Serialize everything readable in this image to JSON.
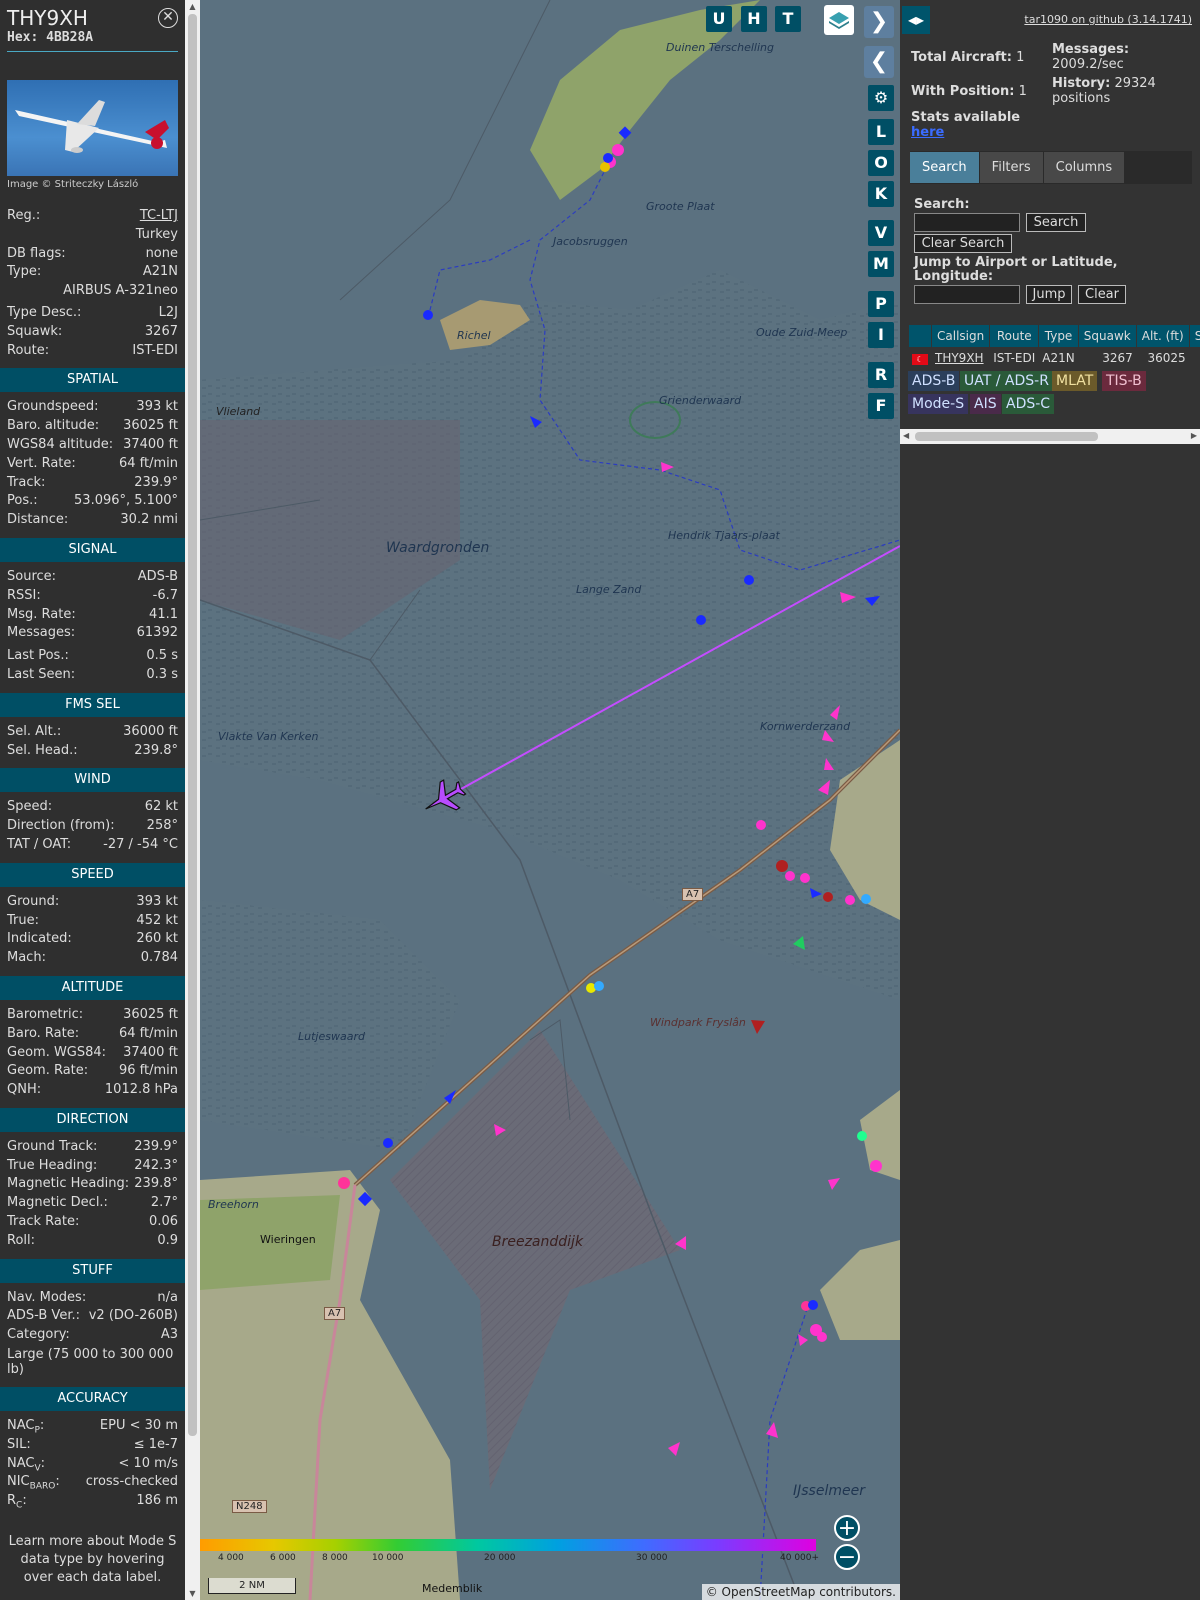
{
  "aircraft": {
    "callsign": "THY9XH",
    "hex": "Hex: 4BB28A",
    "image_credit": "Image © Striteczky László"
  },
  "info": {
    "reg_label": "Reg.:",
    "reg_value": "TC-LTJ",
    "country": "Turkey",
    "dbflags_label": "DB flags:",
    "dbflags_value": "none",
    "type_label": "Type:",
    "type_value": "A21N",
    "type_name": "AIRBUS A-321neo",
    "typedesc_label": "Type Desc.:",
    "typedesc_value": "L2J",
    "squawk_label": "Squawk:",
    "squawk_value": "3267",
    "route_label": "Route:",
    "route_value": "IST-EDI"
  },
  "spatial": {
    "title": "SPATIAL",
    "rows": [
      {
        "k": "Groundspeed:",
        "v": "393 kt"
      },
      {
        "k": "Baro. altitude:",
        "v": "36025 ft"
      },
      {
        "k": "WGS84 altitude:",
        "v": "37400 ft"
      },
      {
        "k": "Vert. Rate:",
        "v": "64 ft/min"
      },
      {
        "k": "Track:",
        "v": "239.9°"
      },
      {
        "k": "Pos.:",
        "v": "53.096°, 5.100°"
      },
      {
        "k": "Distance:",
        "v": "30.2 nmi"
      }
    ]
  },
  "signal": {
    "title": "SIGNAL",
    "rows": [
      {
        "k": "Source:",
        "v": "ADS-B"
      },
      {
        "k": "RSSI:",
        "v": "-6.7"
      },
      {
        "k": "Msg. Rate:",
        "v": "41.1"
      },
      {
        "k": "Messages:",
        "v": "61392"
      },
      {
        "k": "Last Pos.:",
        "v": "0.5 s"
      },
      {
        "k": "Last Seen:",
        "v": "0.3 s"
      }
    ]
  },
  "fms": {
    "title": "FMS SEL",
    "rows": [
      {
        "k": "Sel. Alt.:",
        "v": "36000 ft"
      },
      {
        "k": "Sel. Head.:",
        "v": "239.8°"
      }
    ]
  },
  "wind": {
    "title": "WIND",
    "rows": [
      {
        "k": "Speed:",
        "v": "62 kt"
      },
      {
        "k": "Direction (from):",
        "v": "258°"
      },
      {
        "k": "TAT / OAT:",
        "v": "-27 / -54 °C"
      }
    ]
  },
  "speed": {
    "title": "SPEED",
    "rows": [
      {
        "k": "Ground:",
        "v": "393 kt"
      },
      {
        "k": "True:",
        "v": "452 kt"
      },
      {
        "k": "Indicated:",
        "v": "260 kt"
      },
      {
        "k": "Mach:",
        "v": "0.784"
      }
    ]
  },
  "altitude": {
    "title": "ALTITUDE",
    "rows": [
      {
        "k": "Barometric:",
        "v": "36025 ft"
      },
      {
        "k": "Baro. Rate:",
        "v": "64 ft/min"
      },
      {
        "k": "Geom. WGS84:",
        "v": "37400 ft"
      },
      {
        "k": "Geom. Rate:",
        "v": "96 ft/min"
      },
      {
        "k": "QNH:",
        "v": "1012.8 hPa"
      }
    ]
  },
  "direction": {
    "title": "DIRECTION",
    "rows": [
      {
        "k": "Ground Track:",
        "v": "239.9°"
      },
      {
        "k": "True Heading:",
        "v": "242.3°"
      },
      {
        "k": "Magnetic Heading:",
        "v": "239.8°"
      },
      {
        "k": "Magnetic Decl.:",
        "v": "2.7°"
      },
      {
        "k": "Track Rate:",
        "v": "0.06"
      },
      {
        "k": "Roll:",
        "v": "0.9"
      }
    ]
  },
  "stuff": {
    "title": "STUFF",
    "rows": [
      {
        "k": "Nav. Modes:",
        "v": "n/a"
      },
      {
        "k": "ADS-B Ver.:",
        "v": "v2 (DO-260B)"
      },
      {
        "k": "Category:",
        "v": "A3"
      }
    ],
    "category_desc": "Large (75 000 to 300 000 lb)"
  },
  "accuracy": {
    "title": "ACCURACY",
    "nacp_k": "NAC",
    "nacp_sub": "P",
    "nacp_v": "EPU < 30 m",
    "sil_k": "SIL:",
    "sil_v": "≤ 1e-7",
    "nacv_k": "NAC",
    "nacv_sub": "V",
    "nacv_v": "< 10 m/s",
    "nic_k": "NIC",
    "nic_sub": "BARO",
    "nic_v": "cross-checked",
    "rc_k": "R",
    "rc_sub": "C",
    "rc_v": "186 m"
  },
  "learn_more": "Learn more about Mode S data type by hovering over each data label.",
  "map": {
    "labels": {
      "duinen": "Duinen Terschelling",
      "groote": "Groote Plaat",
      "jacobs": "Jacobsruggen",
      "richel": "Richel",
      "vlieland": "Vlieland",
      "oudezuid": "Oude Zuid-Meep",
      "griender": "Griend­erwaard",
      "waard": "Waardgronden",
      "hendrik": "Hendrik Tjaars-plaat",
      "langezand": "Lange Zand",
      "vlakte": "Vlakte Van Kerken",
      "kornwerd": "Kornwerderzand",
      "windpark": "Windpark Fryslân",
      "lutjes": "Lutjeswaard",
      "breehorn": "Breehorn",
      "wieringen": "Wieringen",
      "breezand": "Breezanddijk",
      "ijssel": "IJsselmeer",
      "medemblik": "Medemblik",
      "a7a": "A7",
      "a7b": "A7",
      "n248": "N248"
    },
    "controls": [
      "U",
      "H",
      "T"
    ],
    "side_controls": [
      "L",
      "O",
      "K",
      "V",
      "M",
      "P",
      "I",
      "R",
      "F"
    ],
    "colorbar_ticks": [
      "4 000",
      "6 000",
      "8 000",
      "10 000",
      "20 000",
      "30 000",
      "40 000+"
    ],
    "scale": "2 NM",
    "attribution": "© OpenStreetMap contributors."
  },
  "right": {
    "github": "tar1090 on github (3.14.1741)",
    "total_label": "Total Aircraft:",
    "total_value": "1",
    "withpos_label": "With Position:",
    "withpos_value": "1",
    "messages_label": "Messages:",
    "messages_value": "2009.2/sec",
    "history_label": "History:",
    "history_value": "29324 positions",
    "stats_text": "Stats available",
    "stats_link": "here",
    "tabs": [
      "Search",
      "Filters",
      "Columns"
    ],
    "search_label": "Search:",
    "search_btn": "Search",
    "clear_search_btn": "Clear Search",
    "jump_label": "Jump to Airport or Latitude, Longitude:",
    "jump_btn": "Jump",
    "clear_btn": "Clear",
    "table": {
      "headers": [
        "Callsign",
        "Route",
        "Type",
        "Squawk",
        "Alt. (ft)",
        "Spd"
      ],
      "row": [
        "THY9XH",
        "IST-EDI",
        "A21N",
        "3267",
        "36025"
      ]
    },
    "legend": [
      {
        "label": "ADS-B",
        "bg": "#2b3f5b"
      },
      {
        "label": "UAT / ADS-R",
        "bg": "#2a5a39"
      },
      {
        "label": "MLAT",
        "bg": "#6b5a2a"
      },
      {
        "label": "TIS-B",
        "bg": "#6b2a3d"
      },
      {
        "label": "Mode-S",
        "bg": "#37345e"
      },
      {
        "label": "AIS",
        "bg": "#4a2a4a"
      },
      {
        "label": "ADS-C",
        "bg": "#2a5a39"
      }
    ]
  }
}
